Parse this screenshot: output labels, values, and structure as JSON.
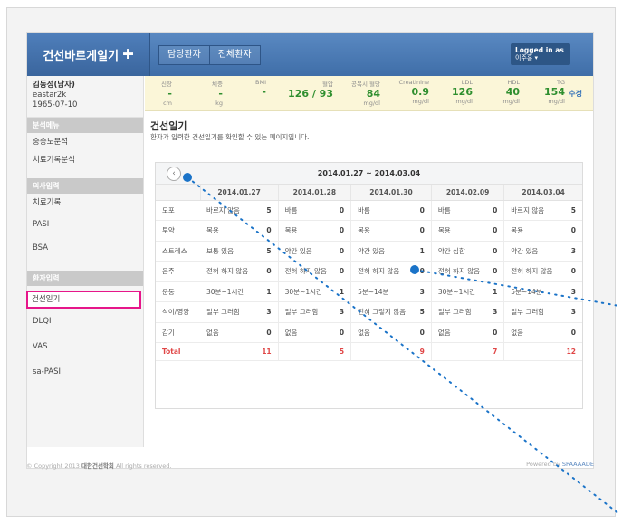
{
  "app": {
    "brand": "건선바르게일기",
    "brand_icon": "plus-icon",
    "tabs": [
      "담당환자",
      "전체환자"
    ],
    "logged_in_label": "Logged in as",
    "logged_in_user": "이주홍 ▾"
  },
  "patient": {
    "name": "김동성(남자)",
    "id": "eastar2k",
    "birth": "1965-07-10"
  },
  "vitals": [
    {
      "label": "신장",
      "value": "-",
      "unit": "cm"
    },
    {
      "label": "체중",
      "value": "-",
      "unit": "kg"
    },
    {
      "label": "BMI",
      "value": "-",
      "unit": ""
    },
    {
      "label": "혈압",
      "value": "126 / 93",
      "unit": ""
    },
    {
      "label": "공복시 혈당",
      "value": "84",
      "unit": "mg/dl"
    },
    {
      "label": "Creatinine",
      "value": "0.9",
      "unit": "mg/dl"
    },
    {
      "label": "LDL",
      "value": "126",
      "unit": "mg/dl"
    },
    {
      "label": "HDL",
      "value": "40",
      "unit": "mg/dl"
    },
    {
      "label": "TG",
      "value": "154",
      "unit": "mg/dl"
    }
  ],
  "edit_label": "수정",
  "sidebar": {
    "sections": [
      {
        "title": "분석메뉴",
        "items": [
          "중증도분석",
          "치료기록분석"
        ]
      },
      {
        "title": "의사입력",
        "items": [
          "치료기록",
          "PASI",
          "BSA"
        ]
      },
      {
        "title": "환자입력",
        "items": [
          "건선일기",
          "DLQI",
          "VAS",
          "sa-PASI"
        ]
      }
    ],
    "active_item": "건선일기"
  },
  "page": {
    "title": "건선일기",
    "subtitle": "환자가 입력한 건선일기를 확인할 수 있는 페이지입니다."
  },
  "diary": {
    "prev_icon": "chevron-left-icon",
    "range": "2014.01.27 ~ 2014.03.04",
    "dates": [
      "2014.01.27",
      "2014.01.28",
      "2014.01.30",
      "2014.02.09",
      "2014.03.04"
    ],
    "rows": [
      {
        "category": "도포",
        "cells": [
          [
            "바르지 않음",
            "5"
          ],
          [
            "바름",
            "0"
          ],
          [
            "바름",
            "0"
          ],
          [
            "바름",
            "0"
          ],
          [
            "바르지 않음",
            "5"
          ]
        ]
      },
      {
        "category": "투약",
        "cells": [
          [
            "복용",
            "0"
          ],
          [
            "복용",
            "0"
          ],
          [
            "복용",
            "0"
          ],
          [
            "복용",
            "0"
          ],
          [
            "복용",
            "0"
          ]
        ]
      },
      {
        "category": "스트레스",
        "cells": [
          [
            "보통 있음",
            "5"
          ],
          [
            "약간 있음",
            "0"
          ],
          [
            "약간 있음",
            "1"
          ],
          [
            "약간 심함",
            "0"
          ],
          [
            "약간 있음",
            "3"
          ]
        ]
      },
      {
        "category": "음주",
        "cells": [
          [
            "전혀 하지 않음",
            "0"
          ],
          [
            "전혀 하지 않음",
            "0"
          ],
          [
            "전혀 하지 않음",
            "0"
          ],
          [
            "전혀 하지 않음",
            "0"
          ],
          [
            "전혀 하지 않음",
            "0"
          ]
        ]
      },
      {
        "category": "운동",
        "cells": [
          [
            "30분~1시간",
            "1"
          ],
          [
            "30분~1시간",
            "1"
          ],
          [
            "5분~14분",
            "3"
          ],
          [
            "30분~1시간",
            "1"
          ],
          [
            "5분~14분",
            "3"
          ]
        ]
      },
      {
        "category": "식이/영양",
        "cells": [
          [
            "일부 그러함",
            "3"
          ],
          [
            "일부 그러함",
            "3"
          ],
          [
            "전혀 그렇지 않음",
            "5"
          ],
          [
            "일부 그러함",
            "3"
          ],
          [
            "일부 그러함",
            "3"
          ]
        ]
      },
      {
        "category": "감기",
        "cells": [
          [
            "없음",
            "0"
          ],
          [
            "없음",
            "0"
          ],
          [
            "없음",
            "0"
          ],
          [
            "없음",
            "0"
          ],
          [
            "없음",
            "0"
          ]
        ]
      }
    ],
    "total_label": "Total",
    "totals": [
      "11",
      "5",
      "9",
      "7",
      "12"
    ]
  },
  "footer": {
    "copyright_prefix": "© Copyright 2013",
    "org": "대한건선학회",
    "copyright_suffix": "All rights reserved.",
    "powered_prefix": "Powered by",
    "powered_by": "SPAAAADE"
  },
  "colors": {
    "header": "#4a79b4",
    "active_highlight": "#e6168a",
    "vital_value": "#2f8f2f",
    "total": "#e04646",
    "marker": "#1a73c8"
  }
}
